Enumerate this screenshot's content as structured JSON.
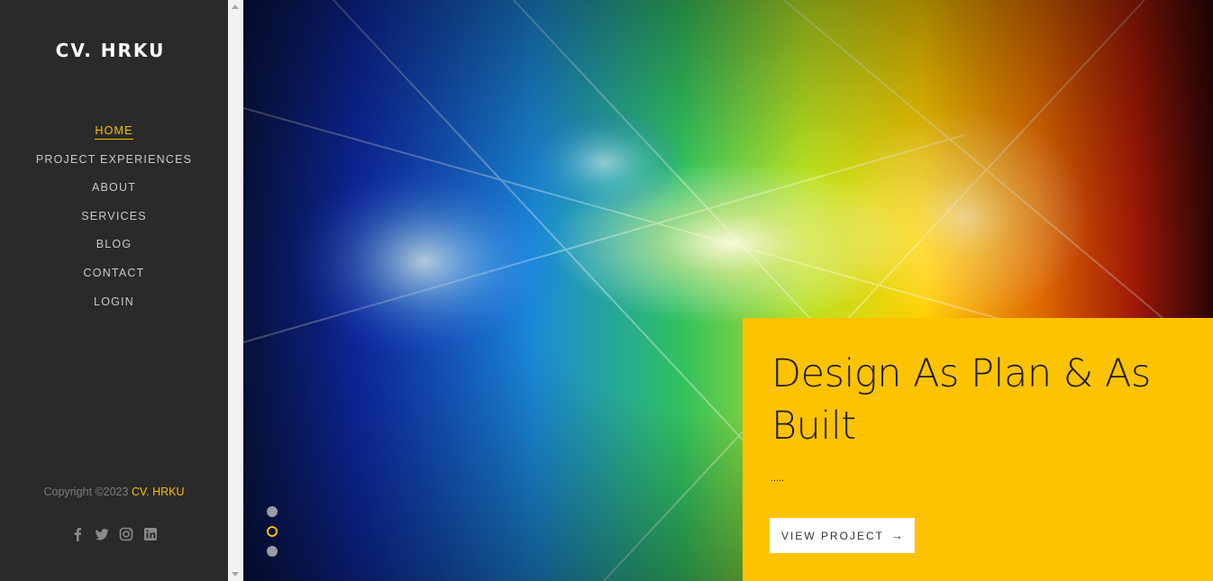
{
  "brand": "CV. HRKU",
  "nav": [
    {
      "label": "HOME",
      "active": true
    },
    {
      "label": "PROJECT EXPERIENCES"
    },
    {
      "label": "ABOUT"
    },
    {
      "label": "SERVICES"
    },
    {
      "label": "BLOG"
    },
    {
      "label": "CONTACT"
    },
    {
      "label": "LOGIN"
    }
  ],
  "footer": {
    "copyright_prefix": "Copyright ©2023 ",
    "copyright_brand": "CV. HRKU"
  },
  "social": [
    "facebook-icon",
    "twitter-icon",
    "instagram-icon",
    "linkedin-icon"
  ],
  "slider": {
    "active_index": 1,
    "dot_count": 3,
    "title": "Design As Plan & As Built",
    "description": ".....",
    "button_label": "VIEW PROJECT",
    "button_icon": "arrow-right-icon"
  },
  "colors": {
    "sidebar": "#2a2a2a",
    "accent": "#f9bf00",
    "caption": "#fec300"
  }
}
